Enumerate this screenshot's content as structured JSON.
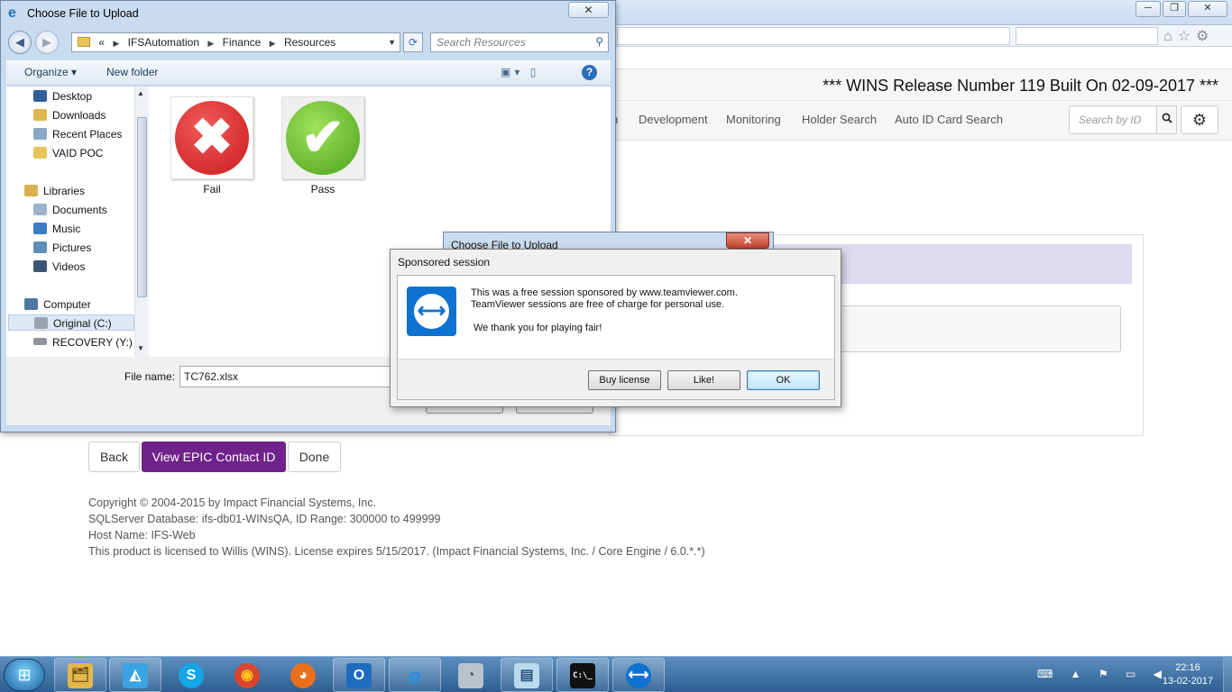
{
  "browser": {
    "min": "─",
    "max": "❐",
    "close": "✕",
    "icons": "⌂☆⚙"
  },
  "app": {
    "release": "*** WINS Release Number 119 Built On 02-09-2017 ***",
    "nav": {
      "partial": "n",
      "development": "Development",
      "monitoring": "Monitoring",
      "holder_search": "Holder Search",
      "auto_id": "Auto ID Card Search",
      "search_placeholder": "Search by ID",
      "search_icon": "search-icon",
      "gear_icon": "gear-icon"
    },
    "buttons": {
      "back": "Back",
      "view_epic": "View EPIC Contact ID",
      "done": "Done"
    },
    "primary_color": "#6f2289",
    "footer": {
      "line1": "Copyright © 2004-2015 by Impact Financial Systems, Inc.",
      "line2": "SQLServer Database: ifs-db01-WINsQA, ID Range: 300000 to 499999",
      "line3": "Host Name: IFS-Web",
      "line4": "This product is licensed to Willis (WINS). License expires 5/15/2017. (Impact Financial Systems, Inc. / Core Engine / 6.0.*.*)"
    }
  },
  "file_dialog": {
    "title": "Choose File to Upload",
    "close": "✕",
    "path": {
      "prefix": "«",
      "parts": [
        "IFSAutomation",
        "Finance",
        "Resources"
      ]
    },
    "search_placeholder": "Search Resources",
    "toolbar": {
      "organize": "Organize ▾",
      "new_folder": "New folder"
    },
    "tree": [
      {
        "label": "Desktop",
        "icon": "desktop-icon",
        "color": "#2f5f9a"
      },
      {
        "label": "Downloads",
        "icon": "downloads-icon",
        "color": "#e0b54a"
      },
      {
        "label": "Recent Places",
        "icon": "recent-places-icon",
        "color": "#8aa7c4"
      },
      {
        "label": "VAID POC",
        "icon": "folder-icon",
        "color": "#e8c55a"
      },
      {
        "label": "Libraries",
        "icon": "libraries-icon",
        "color": "#d9b14e"
      },
      {
        "label": "Documents",
        "icon": "documents-icon",
        "color": "#9bb3cc"
      },
      {
        "label": "Music",
        "icon": "music-icon",
        "color": "#3d7dc8"
      },
      {
        "label": "Pictures",
        "icon": "pictures-icon",
        "color": "#5f8fb6"
      },
      {
        "label": "Videos",
        "icon": "videos-icon",
        "color": "#3c5573"
      },
      {
        "label": "Computer",
        "icon": "computer-icon",
        "color": "#4f77a4"
      },
      {
        "label": "Original (C:)",
        "icon": "drive-icon",
        "color": "#9aa4ae"
      },
      {
        "label": "RECOVERY (Y:)",
        "icon": "drive-icon",
        "color": "#8d959e"
      }
    ],
    "files": [
      {
        "name": "Fail",
        "glyph": "✖"
      },
      {
        "name": "Pass",
        "glyph": "✔"
      }
    ],
    "filename_label": "File name:",
    "filename_value": "TC762.xlsx"
  },
  "file_dialog_2": {
    "title": "Choose File to Upload",
    "close": "✕"
  },
  "teamviewer": {
    "title": "Sponsored session",
    "line1": "This was a free session sponsored by www.teamviewer.com.",
    "line2": "TeamViewer sessions are free of charge for personal use.",
    "line3": "We thank you for playing fair!",
    "buy": "Buy license",
    "like": "Like!",
    "ok": "OK",
    "brand_color": "#0e72d1"
  },
  "taskbar": {
    "start": "⊞",
    "apps": [
      {
        "name": "explorer",
        "glyph": "🗂"
      },
      {
        "name": "azure-devops",
        "glyph": "◭"
      },
      {
        "name": "skype",
        "glyph": "S"
      },
      {
        "name": "chrome",
        "glyph": "◉"
      },
      {
        "name": "firefox",
        "glyph": "◕"
      },
      {
        "name": "outlook",
        "glyph": "O"
      },
      {
        "name": "internet-explorer",
        "glyph": "e"
      },
      {
        "name": "mouse-utility",
        "glyph": "◔"
      },
      {
        "name": "notepad",
        "glyph": "▤"
      },
      {
        "name": "command-prompt",
        "glyph": "C:\\_"
      },
      {
        "name": "teamviewer",
        "glyph": "⟷"
      }
    ],
    "tray": "⌨ ▲ ⚑ ▭ ◀",
    "time": "22:16",
    "date": "13-02-2017"
  }
}
